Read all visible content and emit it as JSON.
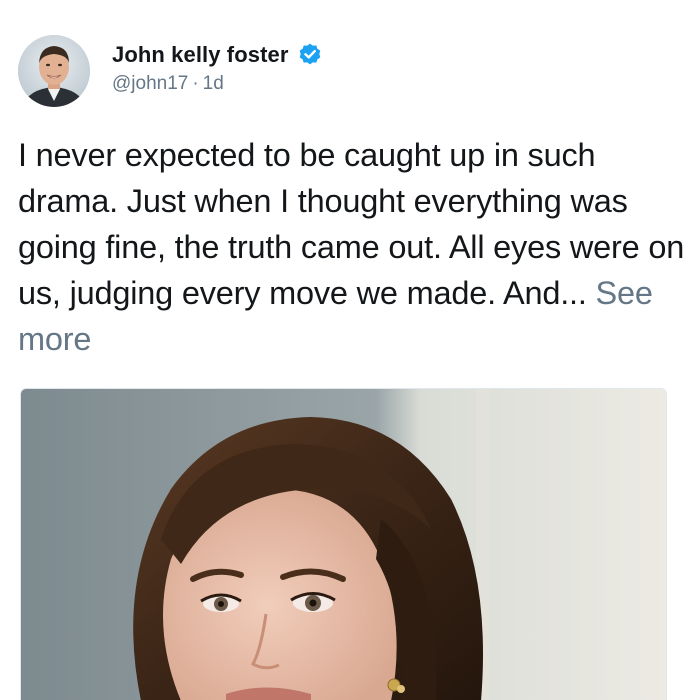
{
  "tweet": {
    "author": {
      "display_name": "John kelly foster",
      "handle": "@john17",
      "separator": "·",
      "time": "1d",
      "verified": true,
      "avatar_icon": "user-avatar-photo",
      "verified_icon": "verified-badge-icon"
    },
    "text": "I never expected to be caught up in such drama. Just when I thought everything was going fine, the truth came out. All eyes were on us, judging every move we made. And...",
    "see_more_label": "See more",
    "media": {
      "type": "photo",
      "icon": "attached-photo"
    },
    "colors": {
      "text": "#14171a",
      "secondary": "#657786",
      "verified": "#1da1f2"
    }
  }
}
